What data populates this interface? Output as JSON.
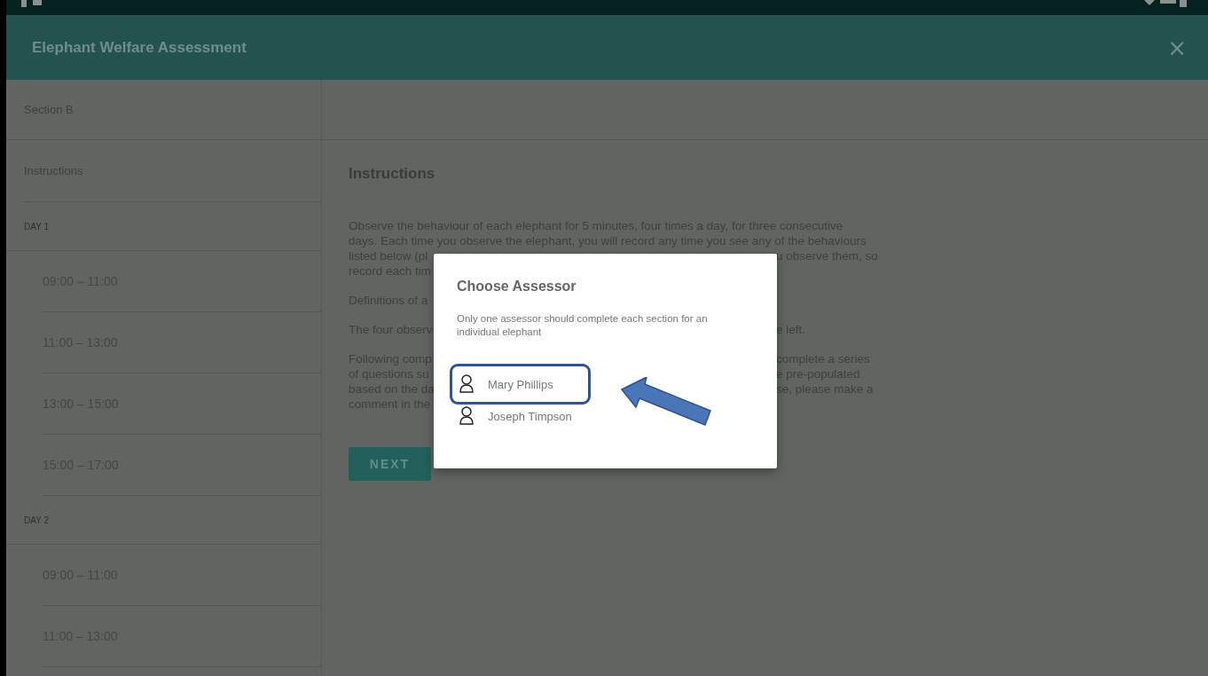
{
  "header": {
    "title": "Elephant Welfare Assessment",
    "close": "×"
  },
  "sidebar": {
    "section_title": "Section B",
    "top_item": "Instructions",
    "days": [
      {
        "label": "DAY 1",
        "slots": [
          "09:00 – 11:00",
          "11:00 – 13:00",
          "13:00 – 15:00",
          "15:00 – 17:00"
        ]
      },
      {
        "label": "DAY 2",
        "slots": [
          "09:00 – 11:00",
          "11:00 – 13:00"
        ]
      }
    ]
  },
  "main": {
    "heading": "Instructions",
    "paragraphs": [
      [
        {
          "kind": "full",
          "text": "Observe the behaviour of each elephant for 5 minutes, four times a day, for three consecutive"
        },
        {
          "kind": "full",
          "text": "days. Each time you observe the elephant, you will record any time you see any of the behaviours"
        },
        {
          "kind": "split",
          "left": "listed below (pl",
          "right": "u observe them, so"
        },
        {
          "kind": "split",
          "left": "record each tim"
        }
      ],
      [
        {
          "kind": "split",
          "left": "Definitions of a"
        }
      ],
      [
        {
          "kind": "split",
          "left": "The four observ",
          "right": "e left."
        }
      ],
      [
        {
          "kind": "split",
          "left": "Following comp",
          "right": "complete a series"
        },
        {
          "kind": "split",
          "left": "of questions su",
          "right": "e pre-populated"
        },
        {
          "kind": "split",
          "left": "based on the da",
          "right": "se, please make a"
        },
        {
          "kind": "split",
          "left": "comment in the"
        }
      ]
    ],
    "next_button": "NEXT"
  },
  "dialog": {
    "title": "Choose Assessor",
    "message": "Only one assessor should complete each section for an individual elephant",
    "assessors": [
      {
        "name": "Mary Phillips",
        "highlighted": true
      },
      {
        "name": "Joseph Timpson",
        "highlighted": false
      }
    ]
  }
}
